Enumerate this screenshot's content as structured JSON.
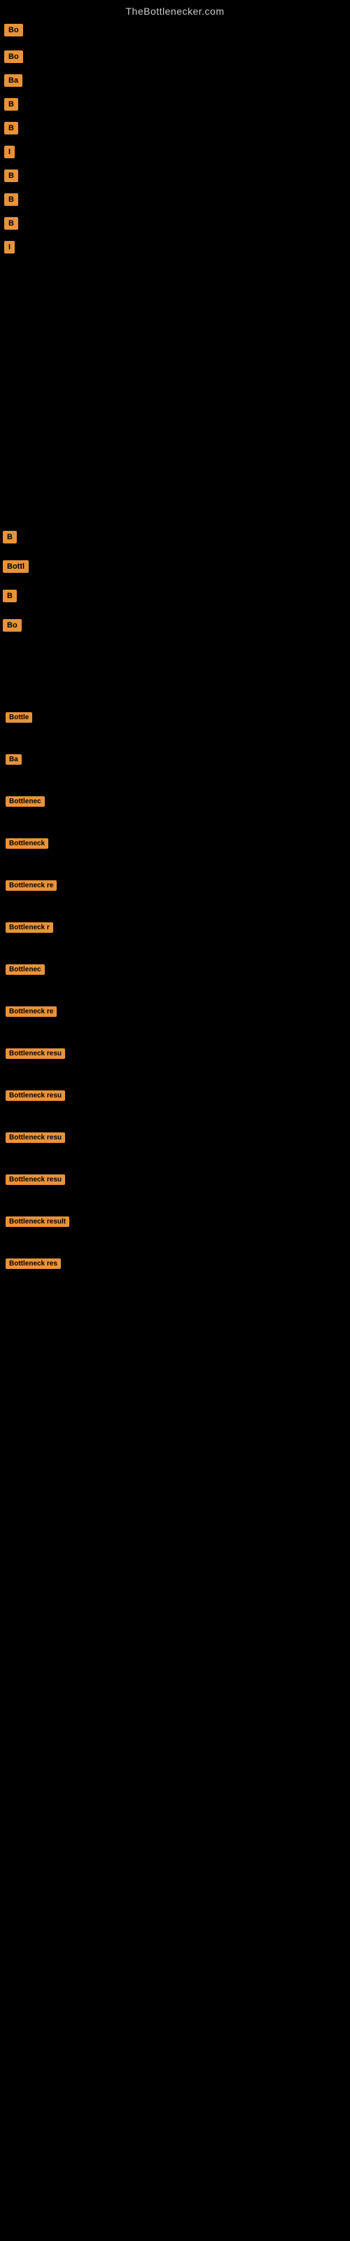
{
  "site": {
    "title": "TheBottlenecker.com"
  },
  "nav": {
    "items": [
      {
        "id": "n1",
        "label": "Bo"
      },
      {
        "id": "n2",
        "label": "Bo"
      },
      {
        "id": "n3",
        "label": "Ba"
      },
      {
        "id": "n4",
        "label": "B"
      },
      {
        "id": "n5",
        "label": "B"
      },
      {
        "id": "n6",
        "label": "I"
      },
      {
        "id": "n7",
        "label": "B"
      },
      {
        "id": "n8",
        "label": "B"
      },
      {
        "id": "n9",
        "label": "B"
      },
      {
        "id": "n10",
        "label": "I"
      }
    ]
  },
  "mid_labels": [
    {
      "id": "m1",
      "label": "B"
    },
    {
      "id": "m2",
      "label": "Bottl"
    },
    {
      "id": "m3",
      "label": "B"
    },
    {
      "id": "m4",
      "label": "Bo"
    }
  ],
  "results": [
    {
      "id": "r1",
      "label": "Bottle"
    },
    {
      "id": "r2",
      "label": "Ba"
    },
    {
      "id": "r3",
      "label": "Bottlenec"
    },
    {
      "id": "r4",
      "label": "Bottleneck"
    },
    {
      "id": "r5",
      "label": "Bottleneck re"
    },
    {
      "id": "r6",
      "label": "Bottleneck r"
    },
    {
      "id": "r7",
      "label": "Bottlenec"
    },
    {
      "id": "r8",
      "label": "Bottleneck re"
    },
    {
      "id": "r9",
      "label": "Bottleneck resu"
    },
    {
      "id": "r10",
      "label": "Bottleneck resu"
    },
    {
      "id": "r11",
      "label": "Bottleneck resu"
    },
    {
      "id": "r12",
      "label": "Bottleneck resu"
    },
    {
      "id": "r13",
      "label": "Bottleneck result"
    },
    {
      "id": "r14",
      "label": "Bottleneck res"
    }
  ]
}
